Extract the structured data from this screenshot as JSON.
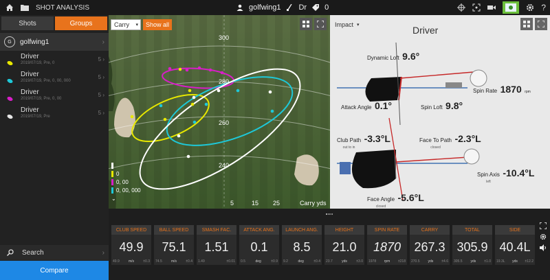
{
  "topbar": {
    "title": "SHOT ANALYSIS",
    "user": "golfwing1",
    "club": "Dr",
    "count": "0"
  },
  "sidebar": {
    "tabs": [
      "Shots",
      "Groups"
    ],
    "user": {
      "initial": "G",
      "name": "golfwing1"
    },
    "groups": [
      {
        "name": "Driver",
        "sub": "2019/07/19, Pre, 0",
        "count": "5",
        "color": "#e8e800"
      },
      {
        "name": "Driver",
        "sub": "2019/07/19, Pre, 0, 00, 000",
        "count": "5",
        "color": "#1ec8d8"
      },
      {
        "name": "Driver",
        "sub": "2019/07/19, Pre, 0, 00",
        "count": "5",
        "color": "#d81ec8"
      },
      {
        "name": "Driver",
        "sub": "2019/07/19, Pre",
        "count": "5",
        "color": "#e6e6e6"
      }
    ],
    "search_label": "Search",
    "compare_label": "Compare"
  },
  "range": {
    "mode": "Carry",
    "show_all": "Show all",
    "distance_labels": [
      "300",
      "280",
      "260",
      "240"
    ],
    "side_labels": [
      "5",
      "15",
      "25"
    ],
    "unit_label": "Carry yds",
    "legend": [
      {
        "label": "",
        "color": "#ffffff"
      },
      {
        "label": "0",
        "color": "#e8e800"
      },
      {
        "label": "0, 00",
        "color": "#d81ec8"
      },
      {
        "label": "0, 00, 000",
        "color": "#1ec8d8"
      }
    ]
  },
  "impact": {
    "mode": "Impact",
    "title": "Driver",
    "dynamic_loft": {
      "label": "Dynamic Loft",
      "value": "9.6°"
    },
    "spin_rate": {
      "label": "Spin Rate",
      "value": "1870",
      "unit": "rpm"
    },
    "attack_angle": {
      "label": "Attack Angle",
      "value": "0.1°"
    },
    "spin_loft": {
      "label": "Spin Loft",
      "value": "9.8°"
    },
    "club_path": {
      "label": "Club Path",
      "value": "-3.3°L",
      "sub": "out to in"
    },
    "face_to_path": {
      "label": "Face To Path",
      "value": "-2.3°L",
      "sub": "closed"
    },
    "spin_axis": {
      "label": "Spin Axis",
      "value": "-10.4°L",
      "sub": "left"
    },
    "face_angle": {
      "label": "Face Angle",
      "value": "-5.6°L",
      "sub": "closed"
    }
  },
  "stats": [
    {
      "header": "CLUB SPEED",
      "value": "49.9",
      "lo": "49.9",
      "unit": "m/s",
      "hi": "±0.3"
    },
    {
      "header": "BALL SPEED",
      "value": "75.1",
      "lo": "74.5",
      "unit": "m/s",
      "hi": "±0.4"
    },
    {
      "header": "SMASH FAC.",
      "value": "1.51",
      "lo": "1.49",
      "unit": "",
      "hi": "±0.01"
    },
    {
      "header": "ATTACK ANG.",
      "value": "0.1",
      "lo": "0.5",
      "unit": "deg",
      "hi": "±0.9"
    },
    {
      "header": "LAUNCH ANG.",
      "value": "8.5",
      "lo": "9.2",
      "unit": "deg",
      "hi": "±0.4"
    },
    {
      "header": "HEIGHT",
      "value": "21.0",
      "lo": "23.7",
      "unit": "yds",
      "hi": "±3.0"
    },
    {
      "header": "SPIN RATE",
      "value": "1870",
      "lo": "1978",
      "unit": "rpm",
      "hi": "±218"
    },
    {
      "header": "CARRY",
      "value": "267.3",
      "lo": "270.5",
      "unit": "yds",
      "hi": "±4.6"
    },
    {
      "header": "TOTAL",
      "value": "305.9",
      "lo": "305.5",
      "unit": "yds",
      "hi": "±1.0"
    },
    {
      "header": "SIDE",
      "value": "40.4L",
      "lo": "19.3L",
      "unit": "yds",
      "hi": "±12.2"
    }
  ]
}
